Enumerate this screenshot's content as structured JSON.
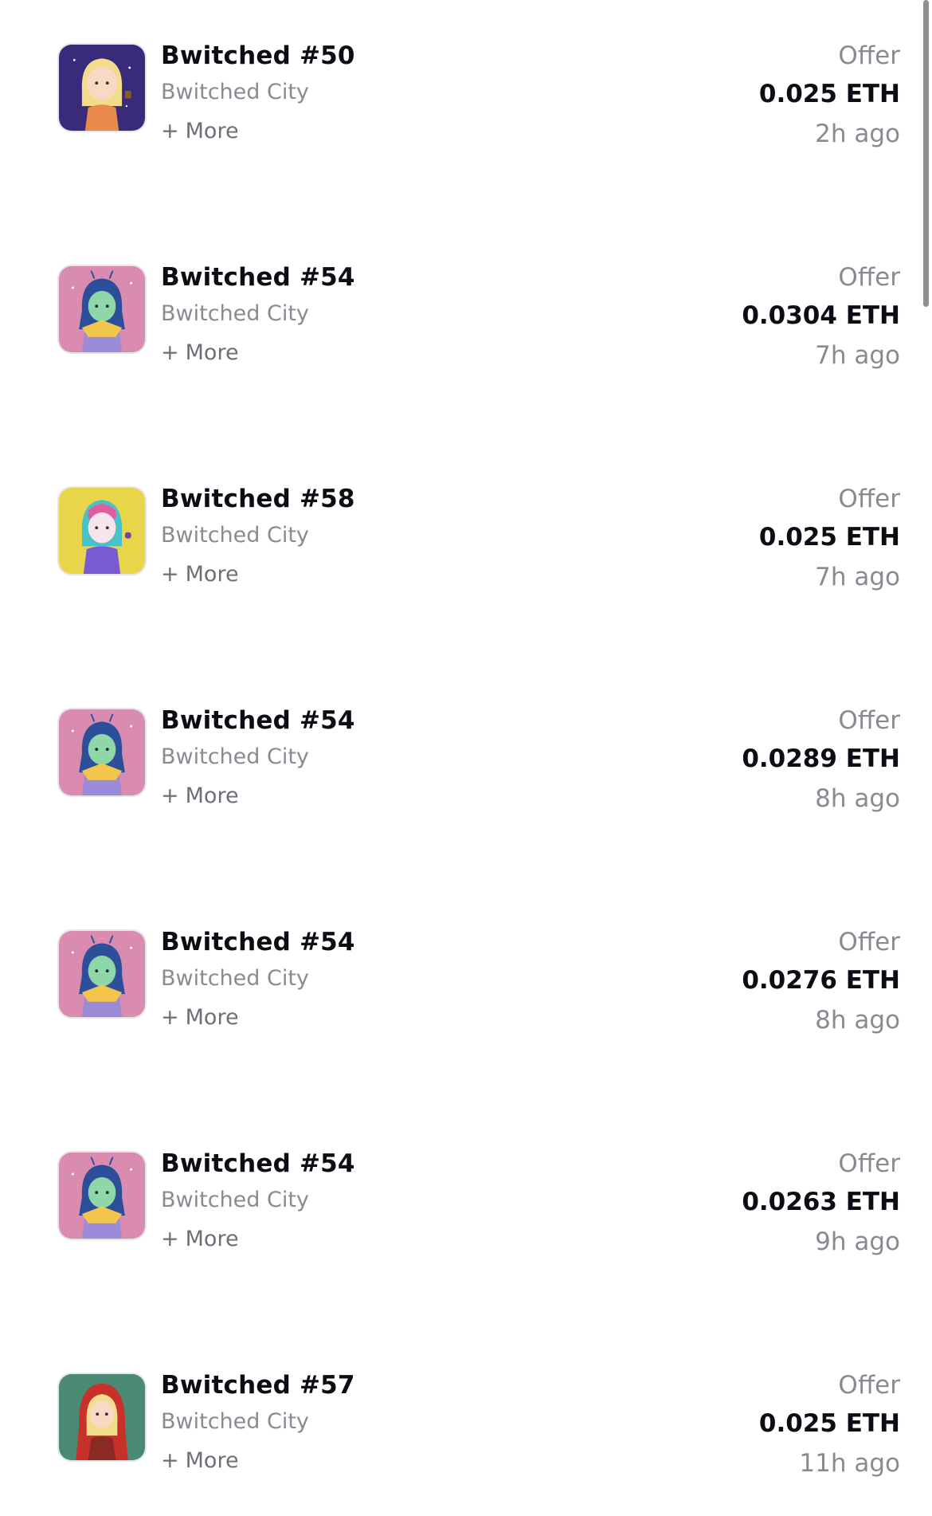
{
  "items": [
    {
      "name": "Bwitched #50",
      "collection": "Bwitched City",
      "more": "More",
      "offer_label": "Offer",
      "price": "0.025 ETH",
      "time": "2h ago",
      "avatar": "girl-navy-bg-icon"
    },
    {
      "name": "Bwitched #54",
      "collection": "Bwitched City",
      "more": "More",
      "offer_label": "Offer",
      "price": "0.0304 ETH",
      "time": "7h ago",
      "avatar": "alien-girl-pink-bg-icon"
    },
    {
      "name": "Bwitched #58",
      "collection": "Bwitched City",
      "more": "More",
      "offer_label": "Offer",
      "price": "0.025 ETH",
      "time": "7h ago",
      "avatar": "rainbow-hair-yellow-bg-icon"
    },
    {
      "name": "Bwitched #54",
      "collection": "Bwitched City",
      "more": "More",
      "offer_label": "Offer",
      "price": "0.0289 ETH",
      "time": "8h ago",
      "avatar": "alien-girl-pink-bg-icon"
    },
    {
      "name": "Bwitched #54",
      "collection": "Bwitched City",
      "more": "More",
      "offer_label": "Offer",
      "price": "0.0276 ETH",
      "time": "8h ago",
      "avatar": "alien-girl-pink-bg-icon"
    },
    {
      "name": "Bwitched #54",
      "collection": "Bwitched City",
      "more": "More",
      "offer_label": "Offer",
      "price": "0.0263 ETH",
      "time": "9h ago",
      "avatar": "alien-girl-pink-bg-icon"
    },
    {
      "name": "Bwitched #57",
      "collection": "Bwitched City",
      "more": "More",
      "offer_label": "Offer",
      "price": "0.025 ETH",
      "time": "11h ago",
      "avatar": "red-hood-green-bg-icon"
    }
  ],
  "colors": {
    "title": "#0c0c14",
    "muted": "#8a8a92",
    "more": "#6e6e78",
    "scrollbar": "#8e8e93"
  }
}
